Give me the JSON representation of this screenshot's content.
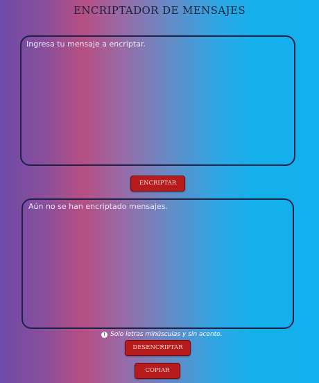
{
  "header": {
    "title": "ENCRIPTADOR DE MENSAJES"
  },
  "input": {
    "placeholder": "Ingresa tu mensaje a encriptar.",
    "value": ""
  },
  "buttons": {
    "encrypt_label": "ENCRIPTAR",
    "decrypt_label": "DESENCRIPTAR",
    "copy_label": "COPIAR"
  },
  "output": {
    "placeholder": "Aún no se han encriptado mensajes.",
    "value": ""
  },
  "hint": {
    "icon": "info-icon",
    "text": "Solo letras minúsculas y sin acento."
  },
  "colors": {
    "button": "#b71b1b",
    "border": "#1e2244",
    "gradient_left": "#6e4aa8",
    "gradient_pink": "#b64f83",
    "gradient_right": "#12b0ee"
  }
}
